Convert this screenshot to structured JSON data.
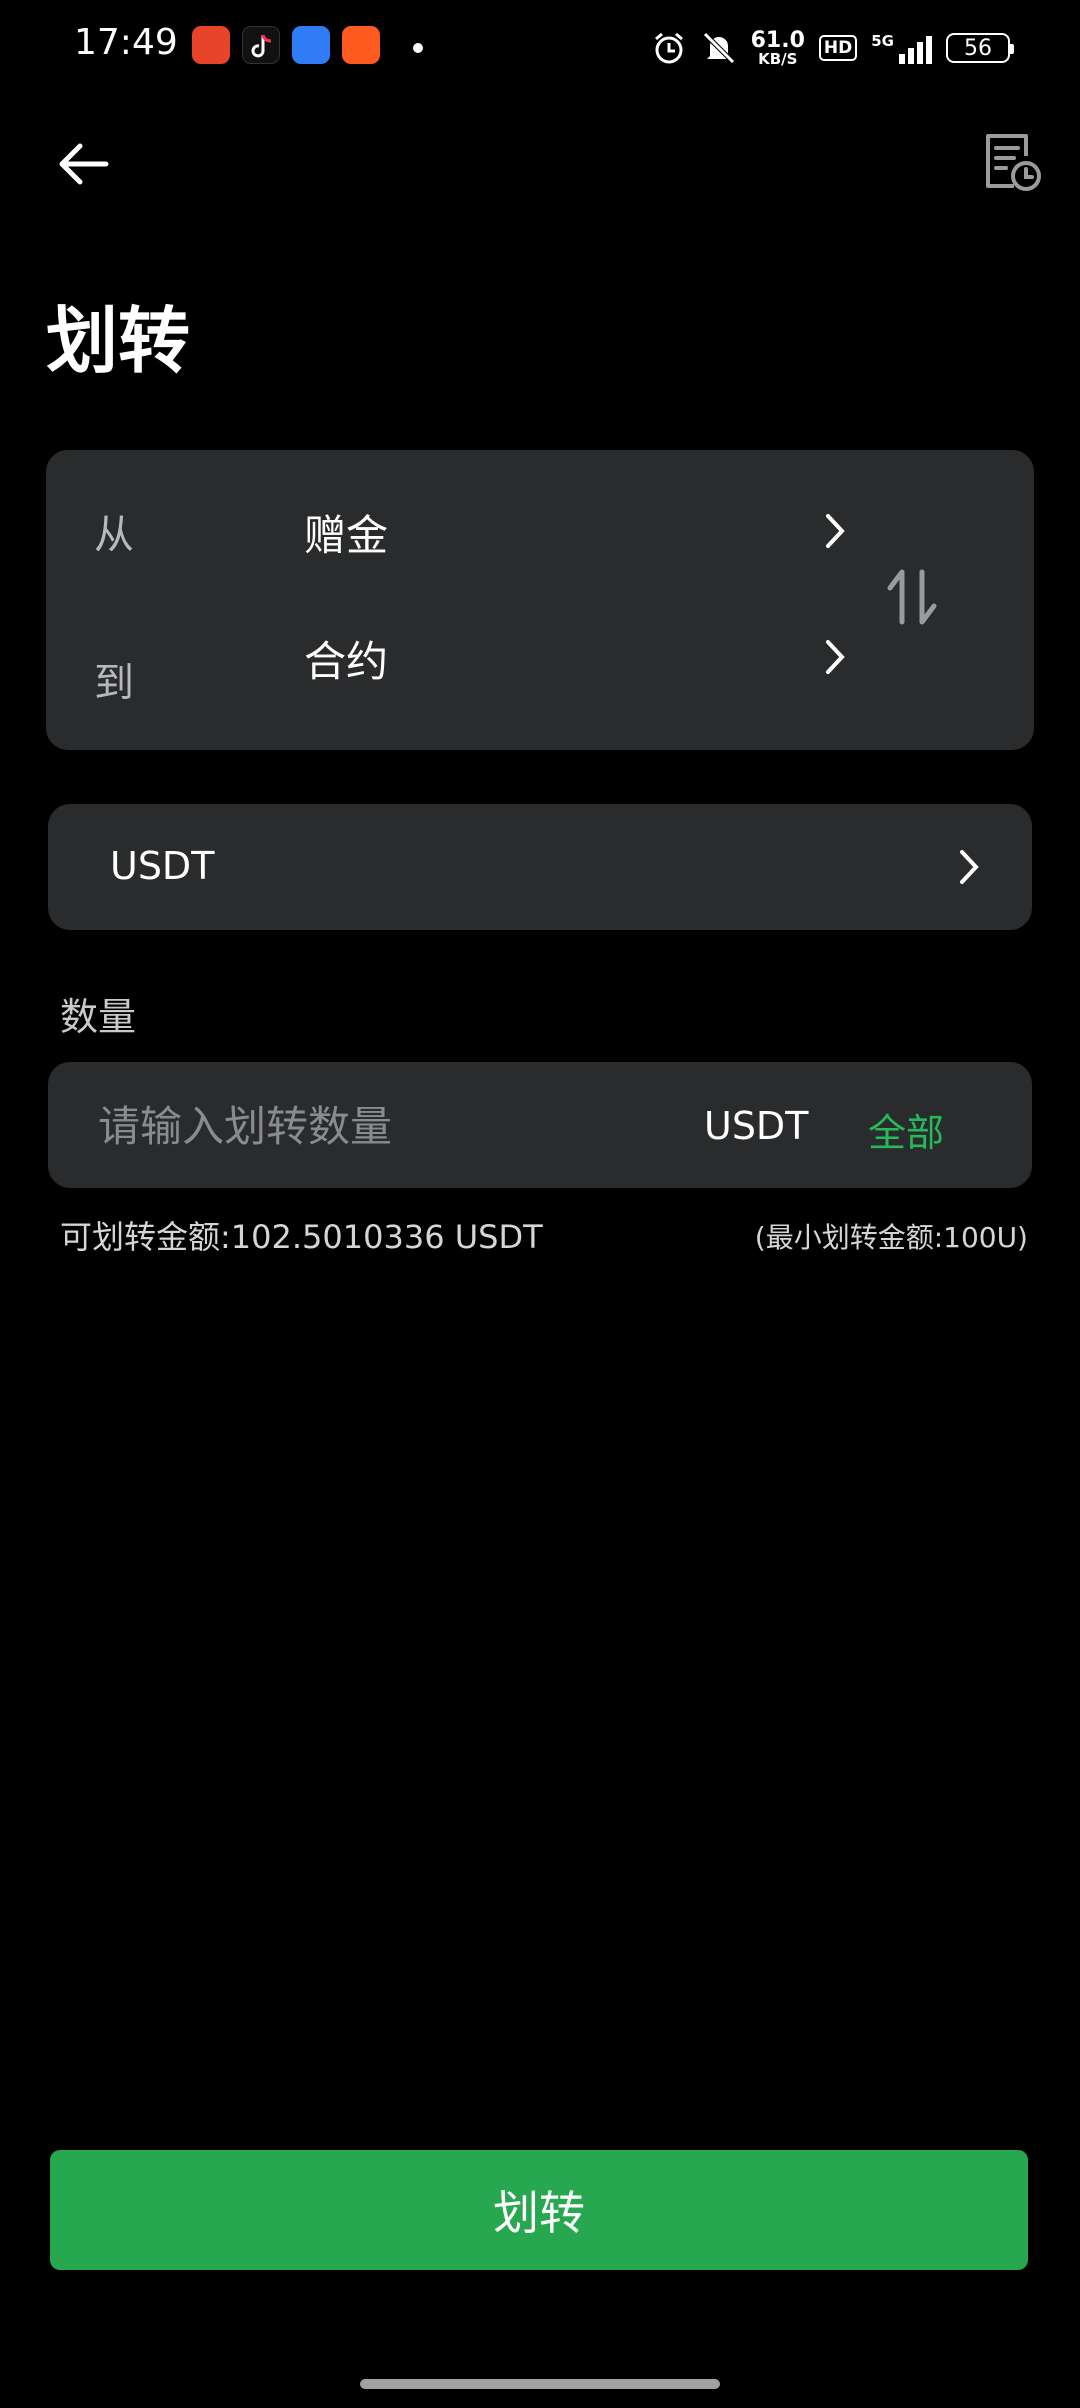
{
  "status_bar": {
    "time": "17:49",
    "net_speed_value": "61.0",
    "net_speed_unit": "KB/S",
    "hd": "HD",
    "network": "5G",
    "battery": "56"
  },
  "header": {
    "title": "划转"
  },
  "transfer": {
    "from_label": "从",
    "from_value": "赠金",
    "to_label": "到",
    "to_value": "合约"
  },
  "currency": {
    "selected": "USDT"
  },
  "quantity": {
    "label": "数量",
    "placeholder": "请输入划转数量",
    "unit": "USDT",
    "all_label": "全部",
    "available": "可划转金额:102.5010336 USDT",
    "minimum": "(最小划转金额:100U)"
  },
  "submit_label": "划转",
  "colors": {
    "accent": "#27a74f",
    "card": "#2a2b2c",
    "background": "#000000"
  }
}
